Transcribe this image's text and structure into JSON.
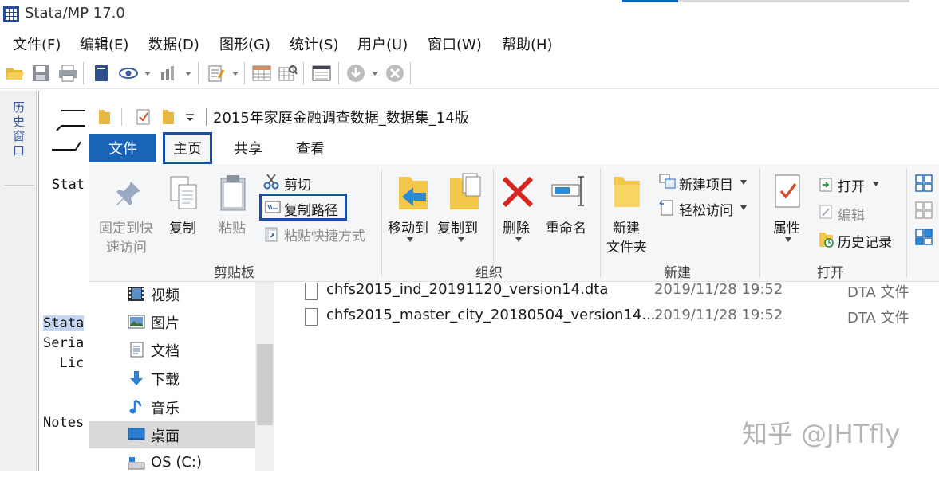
{
  "stata": {
    "title": "Stata/MP 17.0",
    "menus": [
      "文件(F)",
      "编辑(E)",
      "数据(D)",
      "图形(G)",
      "统计(S)",
      "用户(U)",
      "窗口(W)",
      "帮助(H)"
    ],
    "history_tab": "历史窗口",
    "results_lines": [
      "Stat",
      "Stata",
      "Seria",
      "  Lic",
      "Notes"
    ]
  },
  "explorer": {
    "folder_title": "2015年家庭金融调查数据_数据集_14版",
    "tabs": {
      "file": "文件",
      "home": "主页",
      "share": "共享",
      "view": "查看"
    },
    "clipboard": {
      "pin": "固定到快速访问",
      "pin_line1": "固定到快",
      "pin_line2": "速访问",
      "copy": "复制",
      "paste": "粘贴",
      "cut": "剪切",
      "copy_path": "复制路径",
      "paste_shortcut": "粘贴快捷方式",
      "group": "剪贴板"
    },
    "organize": {
      "move_to": "移动到",
      "copy_to": "复制到",
      "delete": "删除",
      "rename": "重命名",
      "group": "组织"
    },
    "new": {
      "new_folder_line1": "新建",
      "new_folder_line2": "文件夹",
      "new_item": "新建项目",
      "easy_access": "轻松访问",
      "group": "新建"
    },
    "open": {
      "properties": "属性",
      "open": "打开",
      "edit": "编辑",
      "history": "历史记录",
      "group": "打开"
    },
    "nav": [
      {
        "label": "视频"
      },
      {
        "label": "图片"
      },
      {
        "label": "文档"
      },
      {
        "label": "下载"
      },
      {
        "label": "音乐"
      },
      {
        "label": "桌面",
        "selected": true
      },
      {
        "label": "OS (C:)"
      }
    ],
    "files": [
      {
        "name": "chfs2015_ind_20191120_version14.dta",
        "date": "2019/11/28 19:52",
        "type": "DTA 文件"
      },
      {
        "name": "chfs2015_master_city_20180504_version14....",
        "date": "2019/11/28 19:52",
        "type": "DTA 文件"
      }
    ]
  },
  "watermark": "知乎 @JHTfly",
  "colors": {
    "accent": "#1a64b8",
    "highlight_box": "#1a4fa8",
    "selected_nav": "#d9d9d9"
  }
}
